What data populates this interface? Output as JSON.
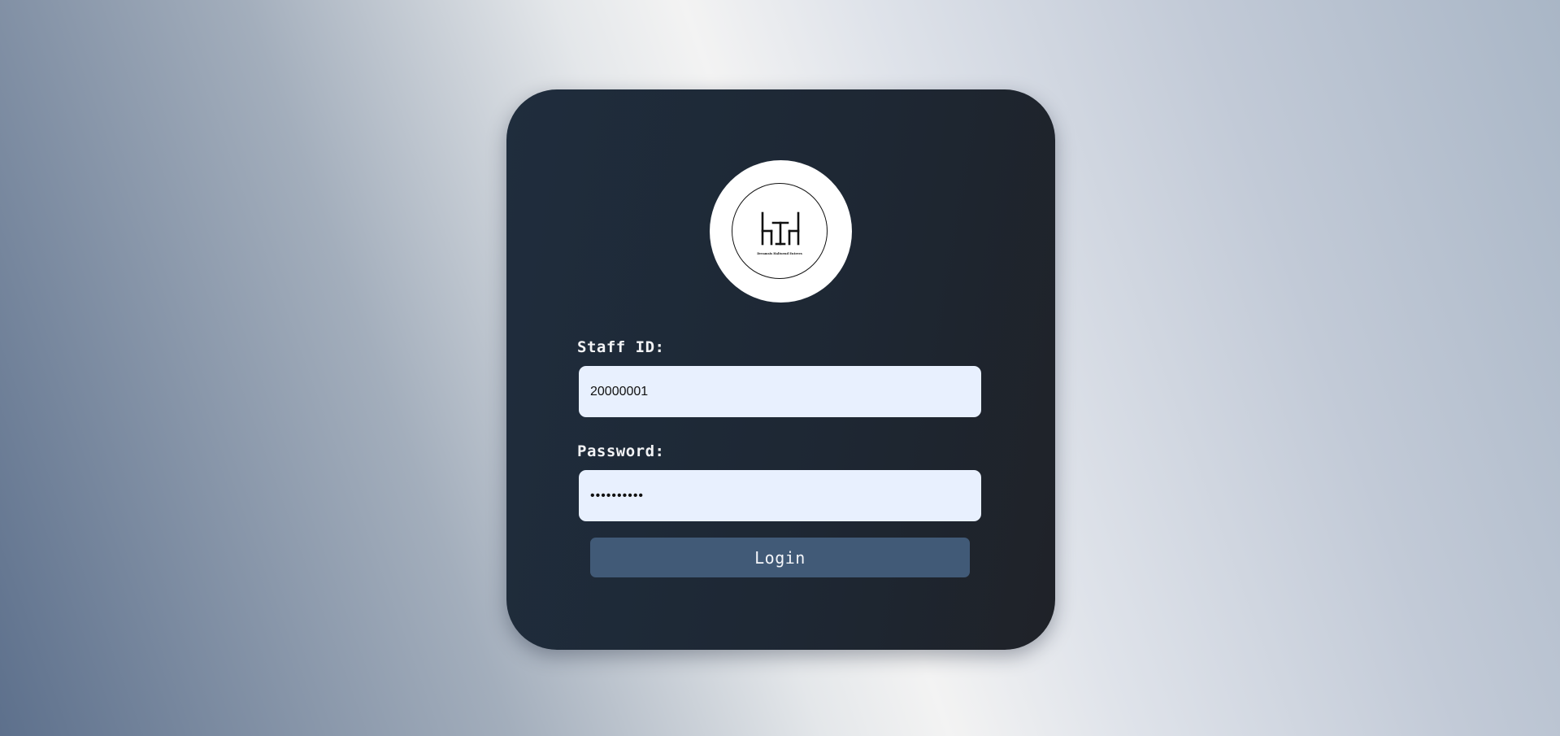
{
  "login": {
    "logo": {
      "icon": "restaurant-logo",
      "caption": "Dreamsis Haltuend Entrees"
    },
    "staff_id": {
      "label": "Staff ID:",
      "value": "20000001"
    },
    "password": {
      "label": "Password:",
      "value": "••••••••••"
    },
    "submit_label": "Login"
  },
  "colors": {
    "card_background": "#1f2a36",
    "input_background": "#e8f0fe",
    "button_background": "#415a77",
    "label_text": "#f2f3f5"
  }
}
